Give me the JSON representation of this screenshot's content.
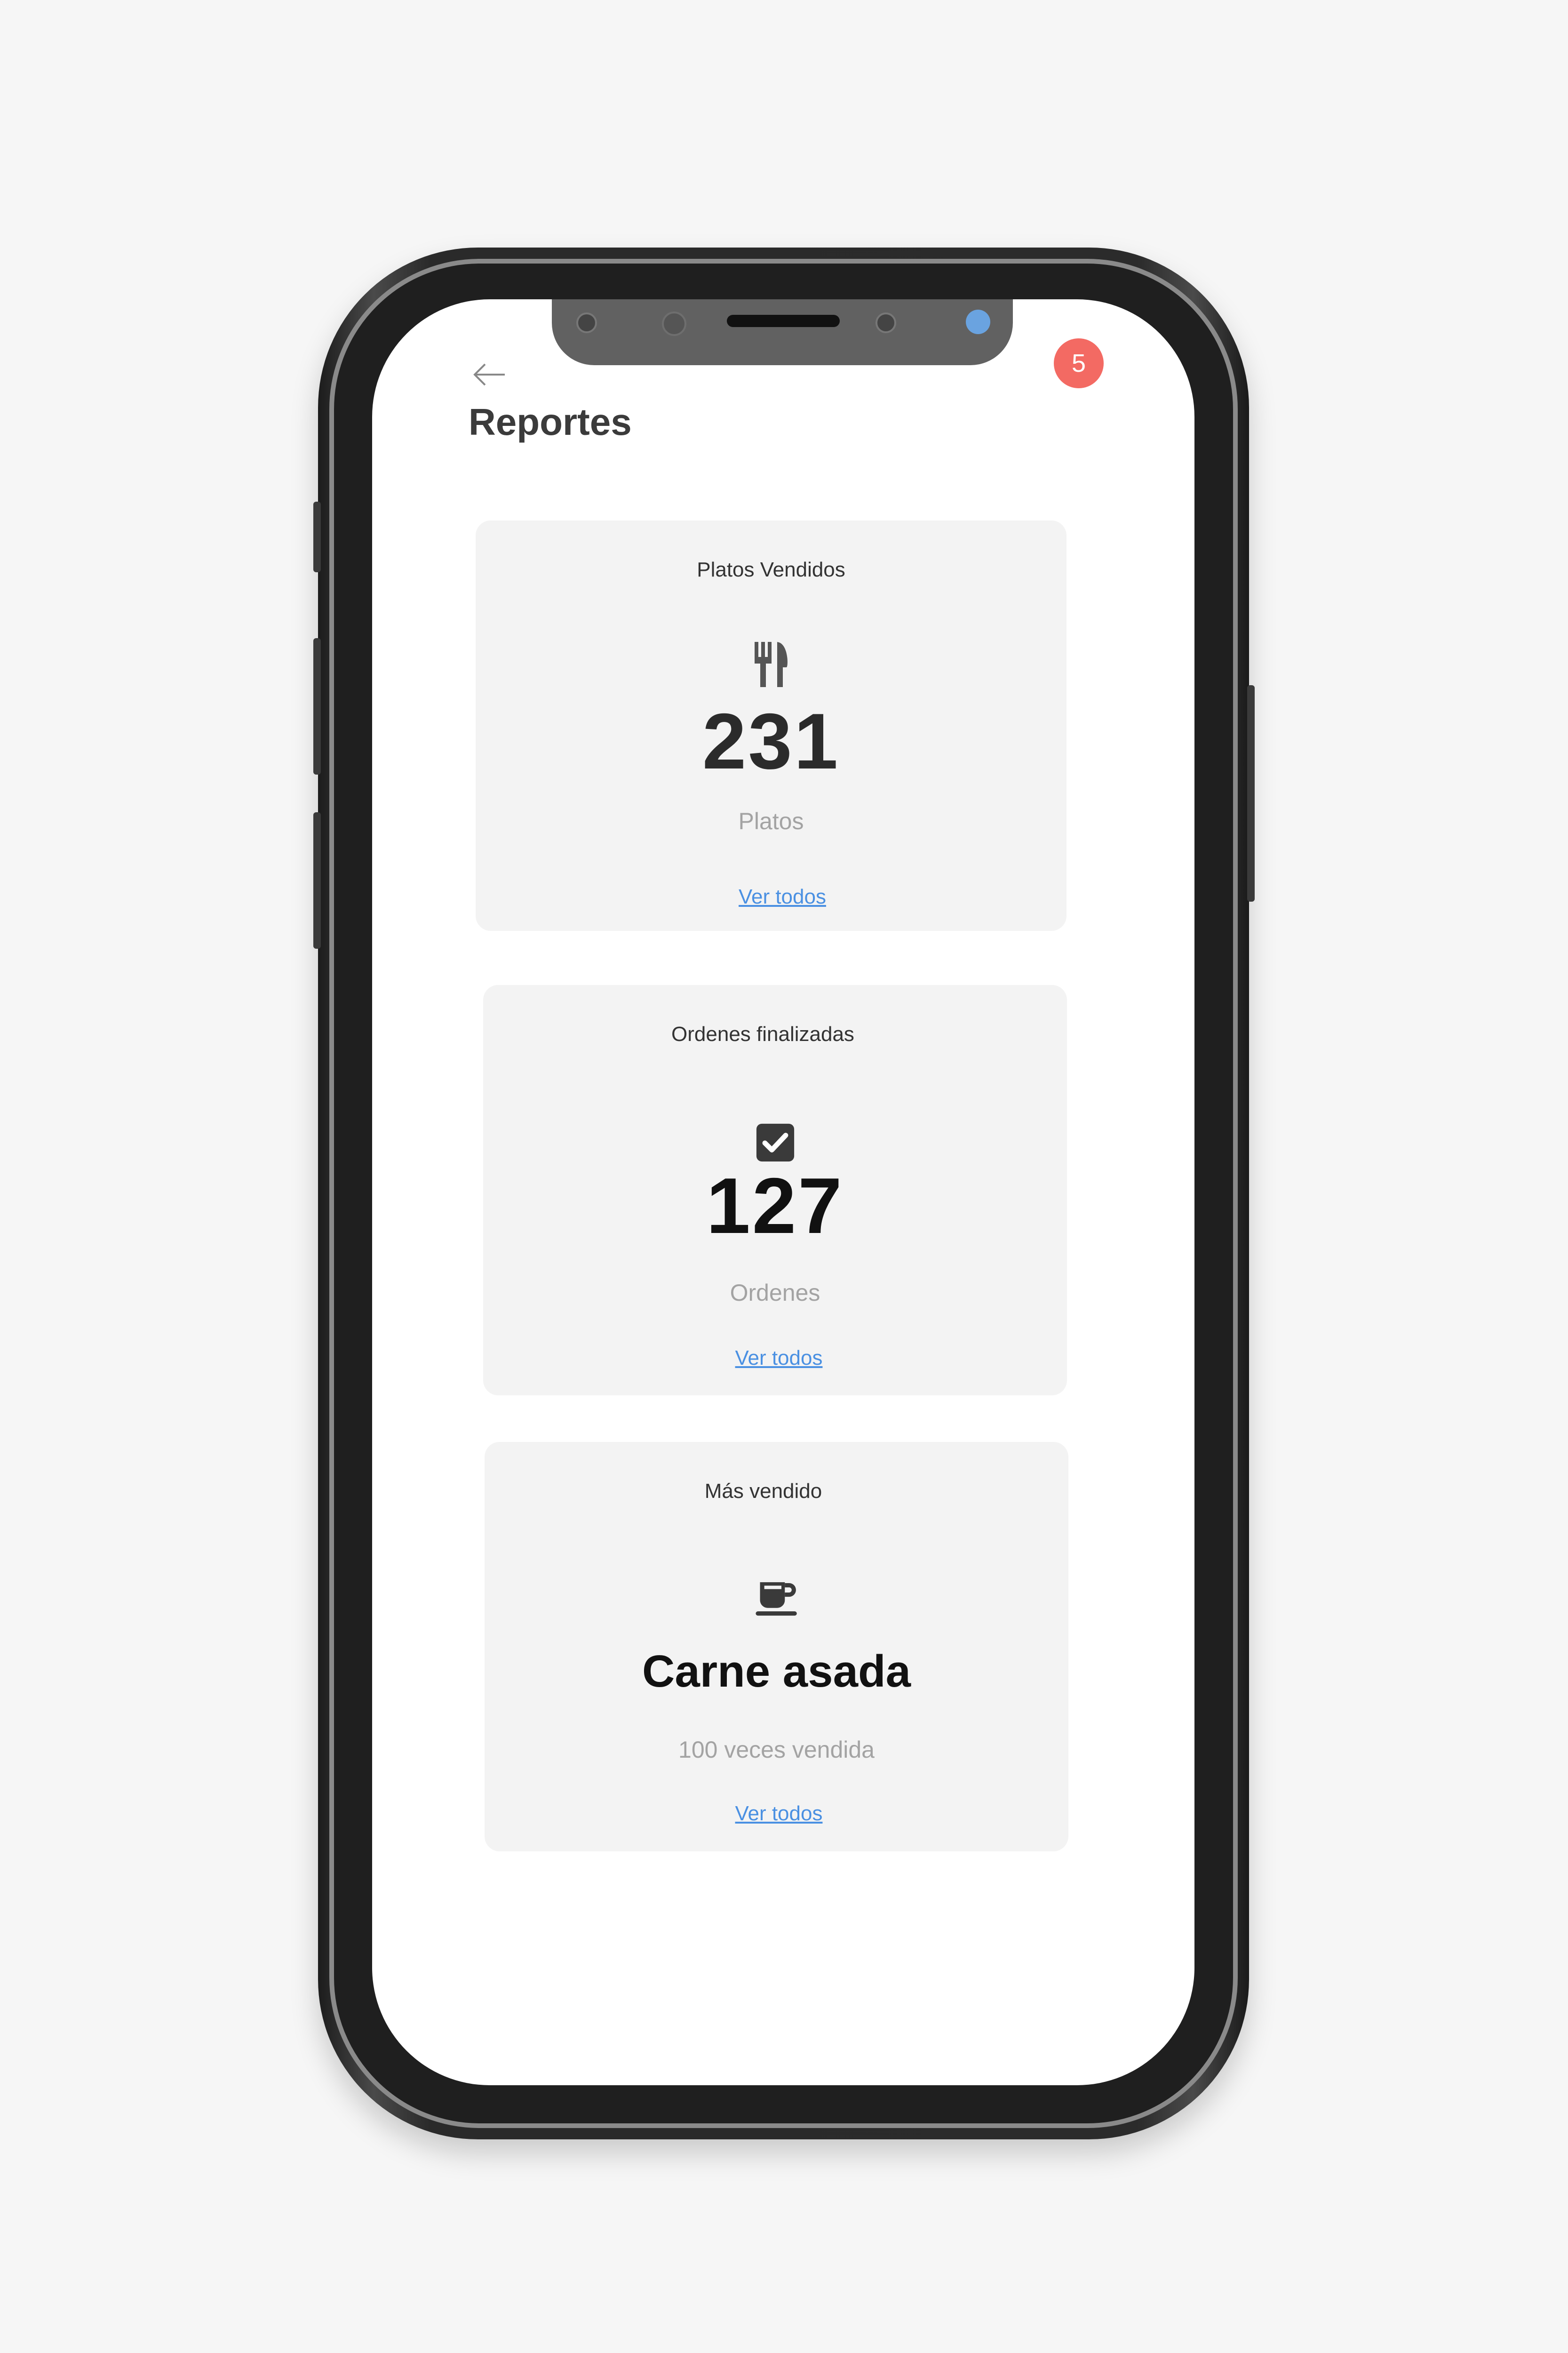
{
  "header": {
    "title": "Reportes",
    "notification_count": "5",
    "back_icon": "arrow-left-icon"
  },
  "colors": {
    "badge": "#f36a63",
    "link": "#4a90e2",
    "card_bg": "#f3f3f3"
  },
  "cards": [
    {
      "title": "Platos Vendidos",
      "icon": "utensils-icon",
      "value": "231",
      "unit": "Platos",
      "link": "Ver todos"
    },
    {
      "title": "Ordenes finalizadas",
      "icon": "check-square-icon",
      "value": "127",
      "unit": "Ordenes",
      "link": "Ver todos"
    },
    {
      "title": "Más vendido",
      "icon": "coffee-cup-icon",
      "value": "Carne asada",
      "unit": "100 veces vendida",
      "link": "Ver todos"
    }
  ]
}
